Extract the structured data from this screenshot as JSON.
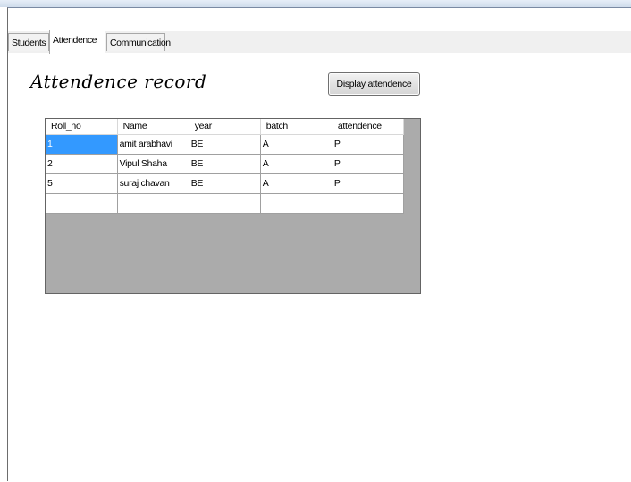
{
  "tabs": [
    {
      "label": "Students"
    },
    {
      "label": "Attendence"
    },
    {
      "label": "Communication"
    }
  ],
  "active_tab": "Attendence",
  "page": {
    "heading": "Attendence record",
    "display_button": "Display attendence"
  },
  "grid": {
    "columns": [
      "Roll_no",
      "Name",
      "year",
      "batch",
      "attendence"
    ],
    "rows": [
      [
        "1",
        "amit arabhavi",
        "BE",
        "A",
        "P"
      ],
      [
        "2",
        "Vipul Shaha",
        "BE",
        "A",
        "P"
      ],
      [
        "5",
        "suraj chavan",
        "BE",
        "A",
        "P"
      ],
      [
        "",
        "",
        "",
        "",
        ""
      ]
    ],
    "selected_cell": {
      "row": 0,
      "col": 0
    },
    "colors": {
      "selection": "#3399ff",
      "empty_area": "#ababab"
    }
  }
}
